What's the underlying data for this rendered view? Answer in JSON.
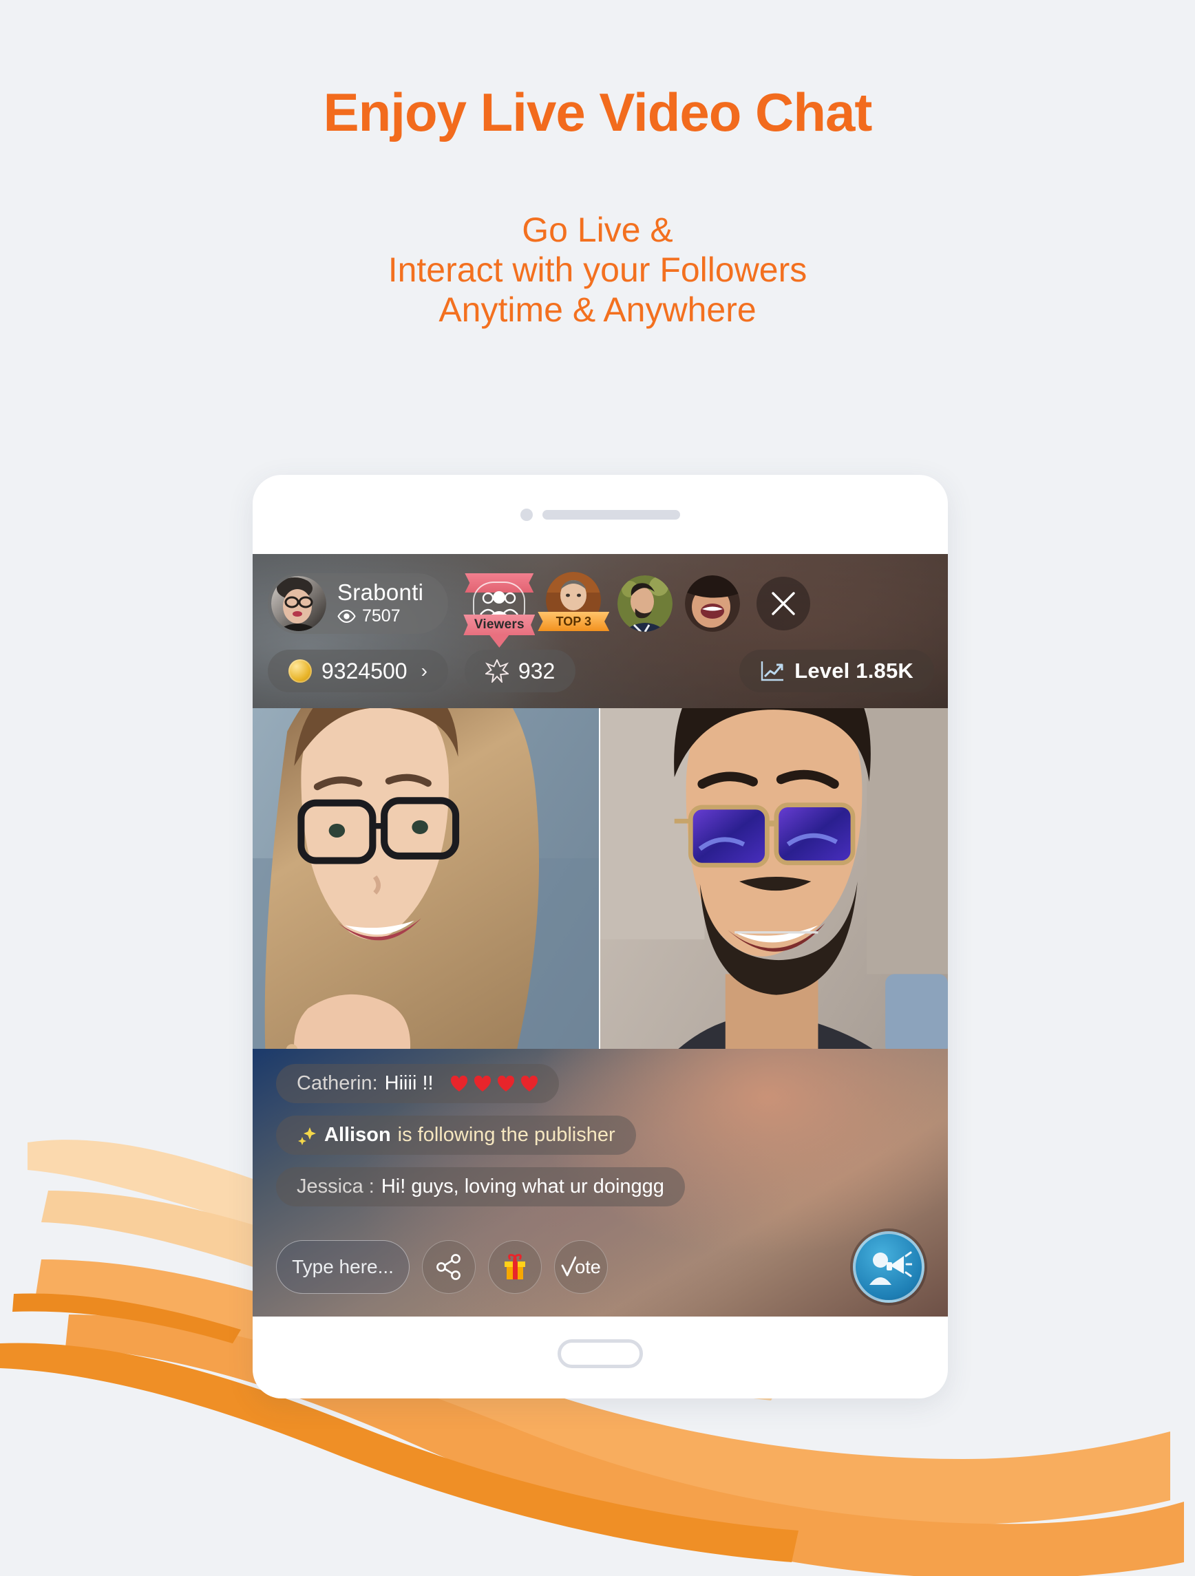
{
  "colors": {
    "background": "#f0f2f5",
    "headline": "#f26b1d",
    "subhead": "#f3701f",
    "brush_light": "#fbd9ae",
    "brush_mid": "#f8ad5e",
    "brush_dark": "#ef8f26",
    "broadcast_blue": "#1e7fb5",
    "heart_red": "#e8252b",
    "gift_yellow": "#f7c11a",
    "bezel_gray": "#d9dce4"
  },
  "headline": "Enjoy Live Video Chat",
  "subhead": {
    "line1": "Go Live &",
    "line2": "Interact with your Followers",
    "line3": "Anytime & Anywhere"
  },
  "device": {
    "camera_icon": "camera-dot",
    "speaker_icon": "speaker-bar",
    "home_button_icon": "home-pill"
  },
  "stream": {
    "header": {
      "publisher_name": "Srabonti",
      "publisher_avatar_icon": "avatar-srabonti",
      "viewers_icon": "eye-icon",
      "viewers_count": "7507",
      "viewers_badge_label": "Viewers",
      "viewers_badge_icon": "people-group-icon",
      "top_badge_label": "TOP 3",
      "top_viewer_avatars": [
        "avatar-viewer-1",
        "avatar-viewer-2",
        "avatar-viewer-3"
      ],
      "close_icon": "close-icon"
    },
    "stats": {
      "coin_icon": "coin-icon",
      "coin_value": "9324500",
      "coin_chevron": "›",
      "star_icon": "star-icon",
      "star_value": "932",
      "level_icon": "trending-chart-icon",
      "level_label": "Level 1.85K"
    },
    "videos": [
      {
        "name": "video-pane-left",
        "subject": "woman-with-glasses"
      },
      {
        "name": "video-pane-right",
        "subject": "man-with-sunglasses"
      }
    ],
    "chat": [
      {
        "type": "message",
        "name": "Catherin:",
        "text": "Hiiii !!",
        "hearts": 4,
        "heart_icon": "heart-icon"
      },
      {
        "type": "follow",
        "icon": "sparkle-icon",
        "name": "Allison",
        "text": "is following the publisher"
      },
      {
        "type": "message",
        "name": "Jessica :",
        "text": "Hi! guys, loving what ur doinggg",
        "hearts": 0
      }
    ],
    "toolbar": {
      "input_placeholder": "Type here...",
      "share_icon": "share-icon",
      "gift_icon": "gift-icon",
      "vote_label": "ote",
      "vote_icon": "check-icon",
      "broadcast_icon": "megaphone-person-icon"
    }
  }
}
